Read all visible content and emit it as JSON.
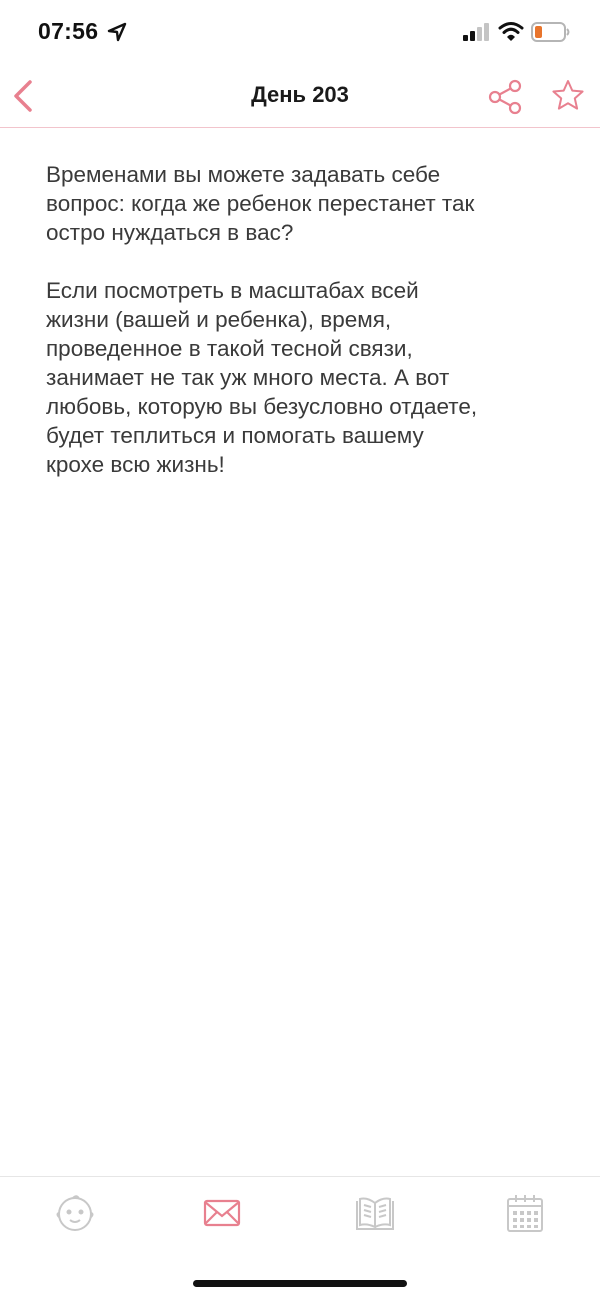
{
  "status_bar": {
    "time": "07:56"
  },
  "nav": {
    "title": "День 203",
    "back_icon": "chevron-left-icon",
    "share_icon": "share-icon",
    "favorite_icon": "star-icon"
  },
  "content": {
    "paragraphs": [
      "Временами вы можете задавать себе\nвопрос: когда же ребенок перестанет так\nостро нуждаться в вас?",
      "Если посмотреть в масштабах всей\nжизни (вашей и ребенка), время,\nпроведенное в такой тесной связи,\nзанимает не так уж много места. А вот\nлюбовь, которую вы безусловно отдаете,\nбудет теплиться и помогать вашему\nкрохе всю жизнь!"
    ]
  },
  "tab_bar": {
    "items": [
      {
        "icon": "baby-face-icon",
        "active": false
      },
      {
        "icon": "envelope-icon",
        "active": true
      },
      {
        "icon": "book-icon",
        "active": false
      },
      {
        "icon": "calendar-icon",
        "active": false
      }
    ]
  },
  "colors": {
    "accent": "#e8808f",
    "inactive": "#c8c8c8",
    "text": "#3a3a3a",
    "divider": "#f2c4cc"
  }
}
